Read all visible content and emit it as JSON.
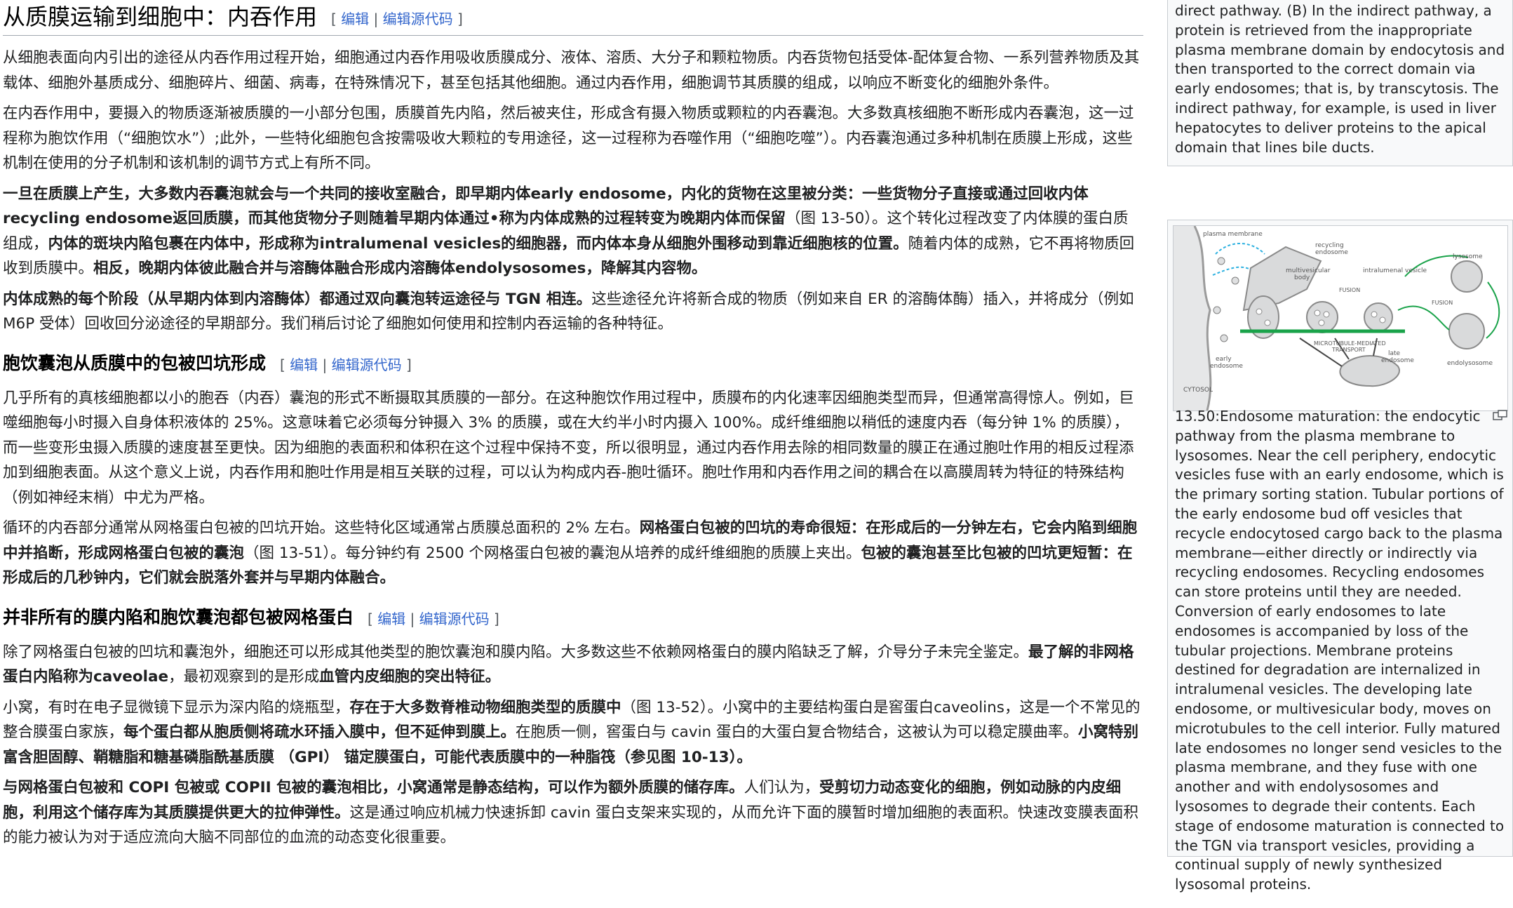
{
  "edit_links": {
    "edit": "编辑",
    "separator": "|",
    "edit_source": "编辑源代码",
    "open": "[",
    "close": "]"
  },
  "section1": {
    "title": "从质膜运输到细胞中：内吞作用",
    "p1": "从细胞表面向内引出的途径从内吞作用过程开始，细胞通过内吞作用吸收质膜成分、液体、溶质、大分子和颗粒物质。内吞货物包括受体-配体复合物、一系列营养物质及其载体、细胞外基质成分、细胞碎片、细菌、病毒，在特殊情况下，甚至包括其他细胞。通过内吞作用，细胞调节其质膜的组成，以响应不断变化的细胞外条件。",
    "p2": "在内吞作用中，要摄入的物质逐渐被质膜的一小部分包围，质膜首先内陷，然后被夹住，形成含有摄入物质或颗粒的内吞囊泡。大多数真核细胞不断形成内吞囊泡，这一过程称为胞饮作用（“细胞饮水”）;此外，一些特化细胞包含按需吸收大颗粒的专用途径，这一过程称为吞噬作用（“细胞吃噬”）。内吞囊泡通过多种机制在质膜上形成，这些机制在使用的分子机制和该机制的调节方式上有所不同。",
    "p3_b1": "一旦在质膜上产生，大多数内吞囊泡就会与一个共同的接收室融合，即早期内体early endosome，内化的货物在这里被分类：一些货物分子直接或通过回收内体recycling endosome返回质膜，而其他货物分子则随着早期内体通过•称为内体成熟的过程转变为晚期内体而保留",
    "p3_t1": "（图 13-50）。这个转化过程改变了内体膜的蛋白质组成，",
    "p3_b2": "内体的斑块内陷包裹在内体中，形成称为intralumenal vesicles的细胞器，而内体本身从细胞外围移动到靠近细胞核的位置。",
    "p3_t2": "随着内体的成熟，它不再将物质回收到质膜中。",
    "p3_b3": "相反，晚期内体彼此融合并与溶酶体融合形成内溶酶体endolysosomes，降解其内容物。",
    "p4_b1": "内体成熟的每个阶段（从早期内体到内溶酶体）都通过双向囊泡转运途径与 TGN 相连。",
    "p4_t1": "这些途径允许将新合成的物质（例如来自 ER 的溶酶体酶）插入，并将成分（例如 M6P 受体）回收回分泌途径的早期部分。我们稍后讨论了细胞如何使用和控制内吞运输的各种特征。"
  },
  "section2": {
    "title": "胞饮囊泡从质膜中的包被凹坑形成",
    "p1": "几乎所有的真核细胞都以小的胞吞（内吞）囊泡的形式不断摄取其质膜的一部分。在这种胞饮作用过程中，质膜布的内化速率因细胞类型而异，但通常高得惊人。例如，巨噬细胞每小时摄入自身体积液体的 25%。这意味着它必须每分钟摄入 3% 的质膜，或在大约半小时内摄入 100%。成纤维细胞以稍低的速度内吞（每分钟 1% 的质膜），而一些变形虫摄入质膜的速度甚至更快。因为细胞的表面积和体积在这个过程中保持不变，所以很明显，通过内吞作用去除的相同数量的膜正在通过胞吐作用的相反过程添加到细胞表面。从这个意义上说，内吞作用和胞吐作用是相互关联的过程，可以认为构成内吞-胞吐循环。胞吐作用和内吞作用之间的耦合在以高膜周转为特征的特殊结构（例如神经末梢）中尤为严格。",
    "p2_t1": "循环的内吞部分通常从网格蛋白包被的凹坑开始。这些特化区域通常占质膜总面积的 2% 左右。",
    "p2_b1": "网格蛋白包被的凹坑的寿命很短：在形成后的一分钟左右，它会内陷到细胞中并掐断，形成网格蛋白包被的囊泡",
    "p2_t2": "（图 13-51）。每分钟约有 2500 个网格蛋白包被的囊泡从培养的成纤维细胞的质膜上夹出。",
    "p2_b2": "包被的囊泡甚至比包被的凹坑更短暂：在形成后的几秒钟内，它们就会脱落外套并与早期内体融合。"
  },
  "section3": {
    "title": "并非所有的膜内陷和胞饮囊泡都包被网格蛋白",
    "p1_t1": "除了网格蛋白包被的凹坑和囊泡外，细胞还可以形成其他类型的胞饮囊泡和膜内陷。大多数这些不依赖网格蛋白的膜内陷缺乏了解，介导分子未完全鉴定。",
    "p1_b1": "最了解的非网格蛋白内陷称为caveolae",
    "p1_t2": "，最初观察到的是形成",
    "p1_b2": "血管内皮细胞的突出特征。",
    "p2_t1": "小窝，有时在电子显微镜下显示为深内陷的烧瓶型，",
    "p2_b1": "存在于大多数脊椎动物细胞类型的质膜中",
    "p2_t2": "（图 13-52）。小窝中的主要结构蛋白是窖蛋白caveolins，这是一个不常见的整合膜蛋白家族，",
    "p2_b2": "每个蛋白都从胞质侧将疏水环插入膜中，但不延伸到膜上。",
    "p2_t3": "在胞质一侧，窖蛋白与 cavin 蛋白的大蛋白复合物结合，这被认为可以稳定膜曲率。",
    "p2_b3": "小窝特别富含胆固醇、鞘糖脂和糖基磷脂酰基质膜 （GPI） 锚定膜蛋白，可能代表质膜中的一种脂筏（参见图 10-13）。",
    "p3_b1": "与网格蛋白包被和 COPI 包被或 COPII 包被的囊泡相比，小窝通常是静态结构，可以作为额外质膜的储存库。",
    "p3_t1": "人们认为，",
    "p3_b2": "受剪切力动态变化的细胞，例如动脉的内皮细胞，利用这个储存库为其质膜提供更大的拉伸弹性。",
    "p3_t2": "这是通过响应机械力快速拆卸 cavin 蛋白支架来实现的，从而允许下面的膜暂时增加细胞的表面积。快速改变膜表面积的能力被认为对于适应流向大脑不同部位的血流的动态变化很重要。"
  },
  "sidebar": {
    "caption1": "direct pathway. (B) In the indirect pathway, a protein is retrieved from the inappropriate plasma membrane domain by endocytosis and then transported to the correct domain via early endosomes; that is, by transcytosis. The indirect pathway, for example, is used in liver hepatocytes to deliver proteins to the apical domain that lines bile ducts.",
    "caption2": "13.50:Endosome maturation: the endocytic pathway from the plasma membrane to lysosomes. Near the cell periphery, endocytic vesicles fuse with an early endosome, which is the primary sorting station. Tubular portions of the early endosome bud off vesicles that recycle endocytosed cargo back to the plasma membrane—either directly or indirectly via recycling endosomes. Recycling endosomes can store proteins until they are needed. Conversion of early endosomes to late endosomes is accompanied by loss of the tubular projections. Membrane proteins destined for degradation are internalized in intralumenal vesicles. The developing late endosome, or multivesicular body, moves on microtubules to the cell interior. Fully matured late endosomes no longer send vesicles to the plasma membrane, and they fuse with one another and with endolysosomes and lysosomes to degrade their contents. Each stage of endosome maturation is connected to the TGN via transport vesicles, providing a continual supply of newly synthesized lysosomal proteins.",
    "figure_labels": {
      "plasma_membrane": "plasma membrane",
      "recycling_endosome_1": "recycling",
      "recycling_endosome_2": "endosome",
      "multivesicular_1": "multivesicular",
      "multivesicular_2": "body",
      "intralumenal": "intralumenal vesicle",
      "lysosome": "lysosome",
      "fusion1": "FUSION",
      "fusion2": "FUSION",
      "microtubule_1": "MICROTUBULE-MEDIATED",
      "microtubule_2": "TRANSPORT",
      "early_1": "early",
      "early_2": "endosome",
      "late_1": "late",
      "late_2": "endosome",
      "endolysosome": "endolysosome",
      "cytosol": "CYTOSOL"
    }
  }
}
